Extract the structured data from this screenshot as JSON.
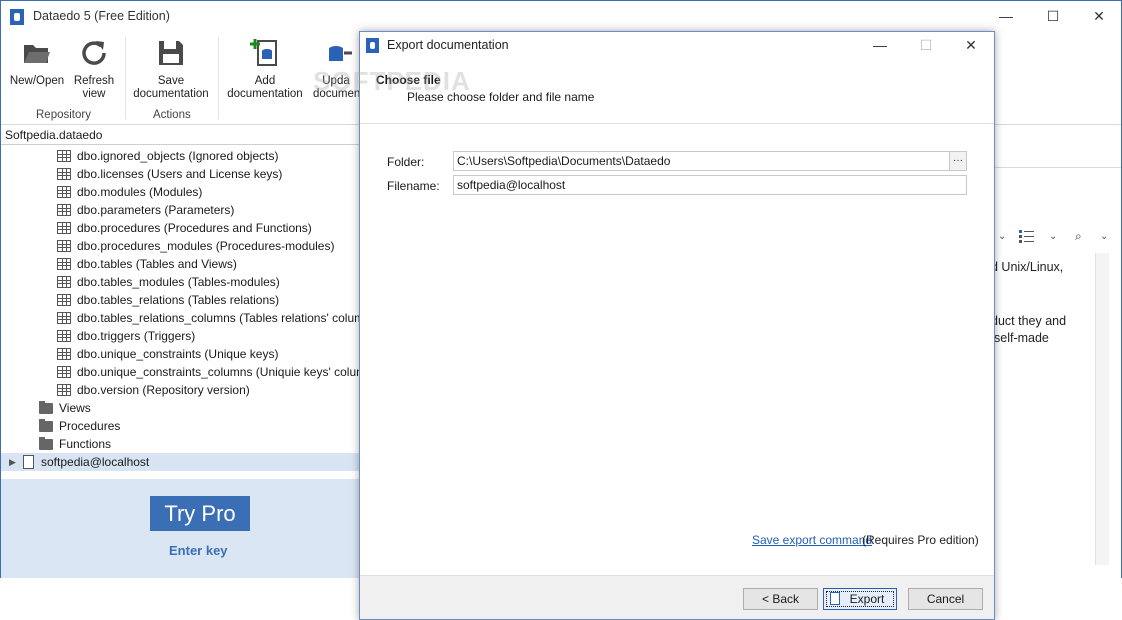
{
  "window": {
    "title": "Dataedo 5 (Free Edition)",
    "minimize": "—",
    "maximize": "☐",
    "close": "✕"
  },
  "ribbon": {
    "new_open": "New/Open",
    "refresh_line1": "Refresh",
    "refresh_line2": "view",
    "group_repository": "Repository",
    "save_line1": "Save",
    "save_line2": "documentation",
    "group_actions": "Actions",
    "add_line1": "Add",
    "add_line2": "documentation",
    "update_line1": "Upda",
    "update_line2": "documen"
  },
  "left_panel": {
    "repository": "Softpedia.dataedo",
    "tree": [
      "dbo.ignored_objects (Ignored objects)",
      "dbo.licenses (Users and License keys)",
      "dbo.modules (Modules)",
      "dbo.parameters (Parameters)",
      "dbo.procedures (Procedures and Functions)",
      "dbo.procedures_modules (Procedures-modules)",
      "dbo.tables (Tables and Views)",
      "dbo.tables_modules (Tables-modules)",
      "dbo.tables_relations (Tables relations)",
      "dbo.tables_relations_columns (Tables relations' columns)",
      "dbo.triggers (Triggers)",
      "dbo.unique_constraints (Unique keys)",
      "dbo.unique_constraints_columns (Uniquie keys' columns)",
      "dbo.version (Repository version)"
    ],
    "folders": [
      "Views",
      "Procedures",
      "Functions"
    ],
    "connection": "softpedia@localhost",
    "try_pro": "Try Pro",
    "enter_key": "Enter key"
  },
  "background_text": {
    "line1": "d Unix/Linux,",
    "line2": "duct they and",
    "line3": "self-made"
  },
  "watermark": "SOFTPEDIA",
  "dialog": {
    "title": "Export documentation",
    "header_title": "Choose file",
    "header_subtitle": "Please choose folder and file name",
    "folder_label": "Folder:",
    "folder_value": "C:\\Users\\Softpedia\\Documents\\Dataedo",
    "browse": "···",
    "filename_label": "Filename:",
    "filename_value": "softpedia@localhost",
    "save_export_command": "Save export command",
    "requires_pro": "(Requires Pro edition)",
    "back": "< Back",
    "export": "Export",
    "cancel": "Cancel"
  },
  "colors": {
    "accent": "#2a62b5",
    "try_pro_bg": "#3a6fb5",
    "panel_bg": "#dbe6f4"
  }
}
